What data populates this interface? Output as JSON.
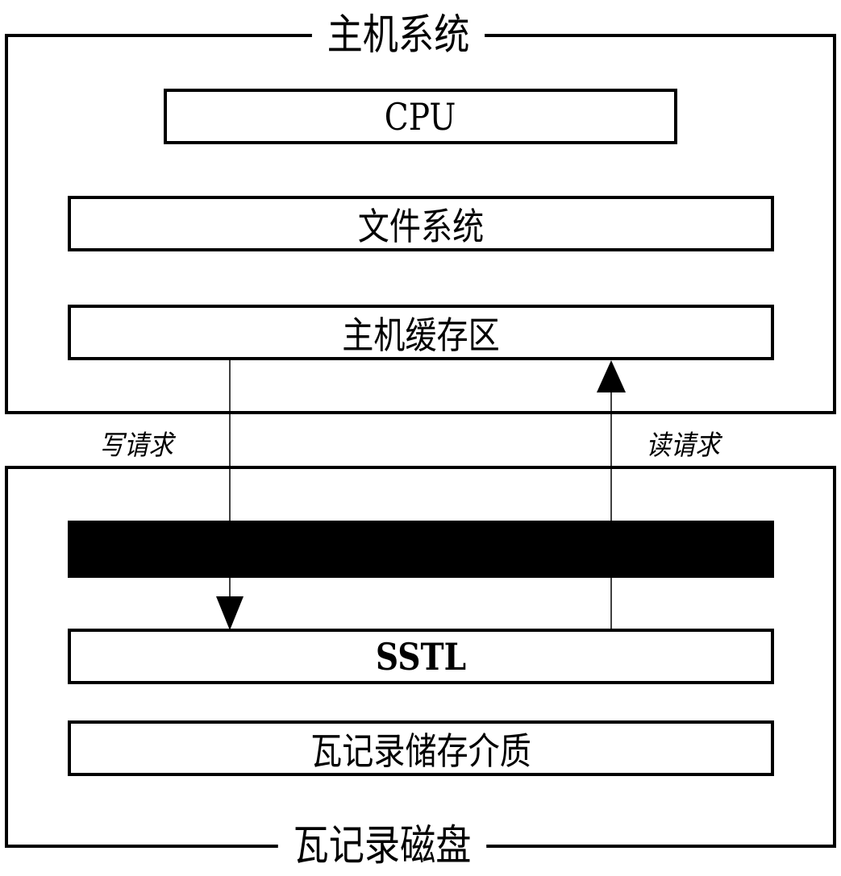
{
  "host_system": {
    "title": "主机系统",
    "layers": [
      {
        "id": "cpu",
        "label": "CPU"
      },
      {
        "id": "file-system",
        "label": "文件系统"
      },
      {
        "id": "host-cache",
        "label": "主机缓存区"
      }
    ]
  },
  "smr_disk": {
    "title": "瓦记录磁盘",
    "layers": [
      {
        "id": "redacted-layer",
        "label": ""
      },
      {
        "id": "sstl",
        "label": "SSTL"
      },
      {
        "id": "smr-medium",
        "label": "瓦记录储存介质"
      }
    ]
  },
  "arrows": {
    "write_label": "写请求",
    "read_label": "读请求"
  }
}
